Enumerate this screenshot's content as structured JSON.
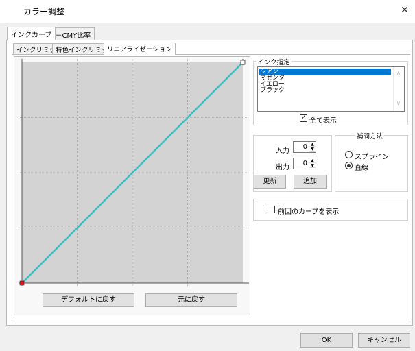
{
  "window": {
    "title": "カラー調整",
    "close_glyph": "✕"
  },
  "outer_tabs": [
    {
      "label": "インクカーブ",
      "active": true
    },
    {
      "label": "K－CMY比率",
      "active": false
    }
  ],
  "inner_tabs": [
    {
      "label": "インクリミット",
      "active": false
    },
    {
      "label": "特色インクリミット",
      "active": false
    },
    {
      "label": "リニアライゼーション",
      "active": true
    }
  ],
  "curve": {
    "line_color": "#2ec4c8",
    "start_point": {
      "input": 0,
      "output": 0,
      "color": "#e0161e"
    },
    "end_point": {
      "input": 100,
      "output": 100,
      "color": "#2ec4c8"
    },
    "grid_divisions": 4
  },
  "buttons": {
    "default": "デフォルトに戻す",
    "revert": "元に戻す",
    "update": "更新",
    "add": "追加",
    "ok": "OK",
    "cancel": "キャンセル"
  },
  "ink_group": {
    "label": "インク指定",
    "items": [
      "シアン",
      "マゼンタ",
      "イエロー",
      "ブラック"
    ],
    "selected_index": 0,
    "show_all_label": "全て表示",
    "show_all_checked": true
  },
  "io": {
    "input_label": "入力",
    "input_value": "0",
    "output_label": "出力",
    "output_value": "0"
  },
  "interp": {
    "label": "補間方法",
    "options": [
      "スプライン",
      "直線"
    ],
    "selected_index": 1
  },
  "previous_curve": {
    "label": "前回のカーブを表示",
    "checked": false
  }
}
